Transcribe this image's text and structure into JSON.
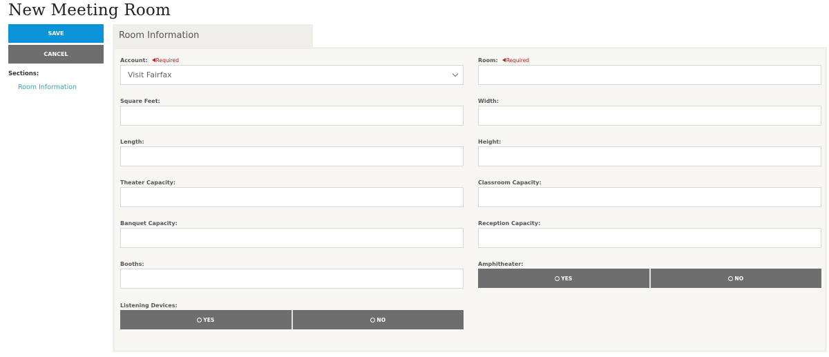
{
  "page": {
    "title": "New Meeting Room"
  },
  "sidebar": {
    "save_label": "SAVE",
    "cancel_label": "CANCEL",
    "sections_label": "Sections:",
    "sections": [
      {
        "label": "Room Information"
      }
    ]
  },
  "tab": {
    "label": "Room Information"
  },
  "form": {
    "required_text": "Required",
    "account": {
      "label": "Account:",
      "value": "Visit Fairfax",
      "required": true
    },
    "room": {
      "label": "Room:",
      "value": "",
      "required": true
    },
    "square_feet": {
      "label": "Square Feet:",
      "value": ""
    },
    "width": {
      "label": "Width:",
      "value": ""
    },
    "length": {
      "label": "Length:",
      "value": ""
    },
    "height": {
      "label": "Height:",
      "value": ""
    },
    "theater_capacity": {
      "label": "Theater Capacity:",
      "value": ""
    },
    "classroom_capacity": {
      "label": "Classroom Capacity:",
      "value": ""
    },
    "banquet_capacity": {
      "label": "Banquet Capacity:",
      "value": ""
    },
    "reception_capacity": {
      "label": "Reception Capacity:",
      "value": ""
    },
    "booths": {
      "label": "Booths:",
      "value": ""
    },
    "amphitheater": {
      "label": "Amphitheater:",
      "yes": "YES",
      "no": "NO",
      "selected": null
    },
    "listening_devices": {
      "label": "Listening Devices:",
      "yes": "YES",
      "no": "NO",
      "selected": null
    }
  },
  "colors": {
    "primary": "#0b93d8",
    "secondary": "#6e6e6e",
    "required": "#b02020",
    "link": "#3a9fb8"
  }
}
